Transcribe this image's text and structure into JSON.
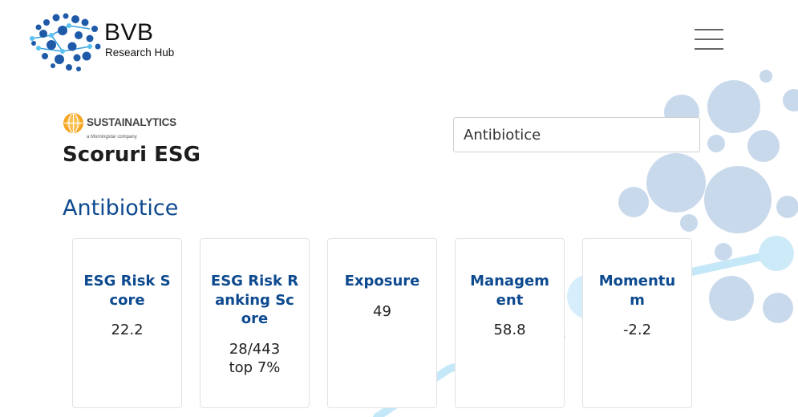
{
  "brand": {
    "name": "BVB",
    "tagline": "Research Hub"
  },
  "provider": {
    "name": "SUSTAINALYTICS",
    "sub": "a Morningstar company"
  },
  "page_title": "Scoruri ESG",
  "search": {
    "value": "Antibiotice"
  },
  "company": "Antibiotice",
  "cards": [
    {
      "title": "ESG Risk Score",
      "value": "22.2"
    },
    {
      "title": "ESG Risk Ranking Score",
      "value": "28/443",
      "value2": "top 7%"
    },
    {
      "title": "Exposure",
      "value": "49"
    },
    {
      "title": "Managem ent",
      "value": "58.8"
    },
    {
      "title": "Momentu m",
      "value": "-2.2"
    }
  ],
  "icons": {
    "menu": "hamburger-menu-icon",
    "logo": "brain-dots-logo",
    "provider": "sustainalytics-globe-icon"
  },
  "colors": {
    "accent": "#0d4a8f",
    "bubble": "#c9d9ec",
    "line": "#bfe6f7"
  }
}
